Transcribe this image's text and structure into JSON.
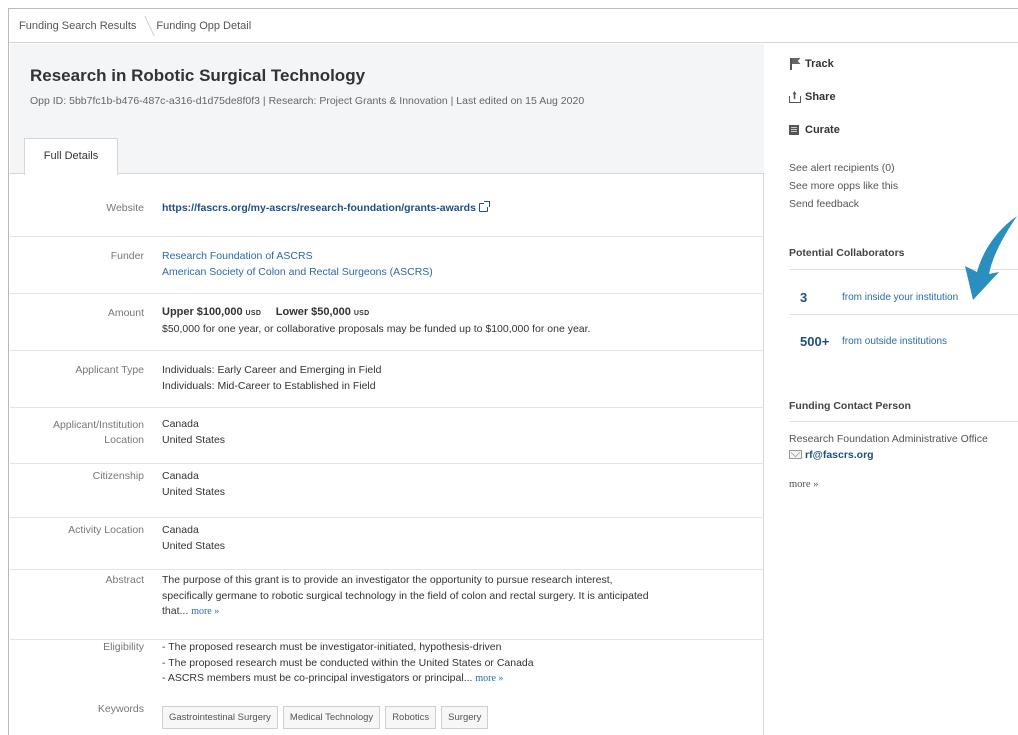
{
  "breadcrumb": {
    "items": [
      "Funding Search Results",
      "Funding Opp Detail"
    ]
  },
  "opp": {
    "title": "Research in Robotic Surgical Technology",
    "meta": "Opp ID: 5bb7fc1b-b476-487c-a316-d1d75de8f0f3  |  Research: Project Grants & Innovation  |  Last edited on 15 Aug 2020",
    "tab": "Full Details"
  },
  "details": {
    "website": {
      "label": "Website",
      "value": "https://fascrs.org/my-ascrs/research-foundation/grants-awards"
    },
    "funder": {
      "label": "Funder",
      "lines": [
        "Research Foundation of ASCRS",
        "American Society of Colon and Rectal Surgeons (ASCRS)"
      ]
    },
    "amount": {
      "label": "Amount",
      "upper_label": "Upper",
      "upper_value": "$100,000",
      "lower_label": "Lower",
      "lower_value": "$50,000",
      "currency": "USD",
      "note": "$50,000 for one year, or collaborative proposals may be funded up to $100,000 for one year."
    },
    "applicant_type": {
      "label": "Applicant Type",
      "lines": [
        "Individuals: Early Career and Emerging in Field",
        "Individuals: Mid-Career to Established in Field"
      ]
    },
    "applicant_location": {
      "label_line1": "Applicant/Institution",
      "label_line2": "Location",
      "lines": [
        "Canada",
        "United States"
      ]
    },
    "citizenship": {
      "label": "Citizenship",
      "lines": [
        "Canada",
        "United States"
      ]
    },
    "activity_location": {
      "label": "Activity Location",
      "lines": [
        "Canada",
        "United States"
      ]
    },
    "abstract": {
      "label": "Abstract",
      "lines": [
        "The purpose of this grant is to provide an investigator the opportunity to pursue research interest,",
        "specifically germane to robotic surgical technology in the field of colon and rectal surgery. It is anticipated",
        "that..."
      ],
      "more": "more »"
    },
    "eligibility": {
      "label": "Eligibility",
      "lines": [
        "- The proposed research must be investigator-initiated, hypothesis-driven",
        "- The proposed research must be conducted within the United States or Canada",
        "- ASCRS members must be co-principal investigators or principal..."
      ],
      "more": "more »"
    },
    "keywords": {
      "label": "Keywords",
      "items": [
        "Gastrointestinal Surgery",
        "Medical Technology",
        "Robotics",
        "Surgery"
      ]
    }
  },
  "sidebar": {
    "track": "Track",
    "share": "Share",
    "curate": "Curate",
    "links": [
      "See alert recipients  (0)",
      "See more opps like this",
      "Send feedback"
    ],
    "collab_heading": "Potential Collaborators",
    "collab_inside_count": "3",
    "collab_inside_text": "from inside your institution",
    "collab_outside_count": "500+",
    "collab_outside_text": "from outside institutions",
    "contact_heading": "Funding Contact Person",
    "contact_name": "Research Foundation Administrative Office",
    "contact_email": "rf@fascrs.org",
    "contact_more": "more »",
    "arrow_color": "#2a8fbf"
  }
}
